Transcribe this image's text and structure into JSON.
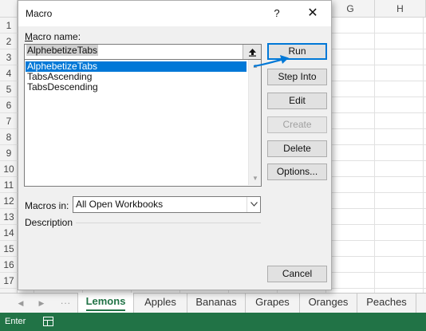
{
  "spreadsheet": {
    "columns": [
      "G",
      "H"
    ],
    "rows": [
      "1",
      "2",
      "3",
      "4",
      "5",
      "6",
      "7",
      "8",
      "9",
      "10",
      "11",
      "12",
      "13",
      "14",
      "15",
      "16",
      "17"
    ]
  },
  "sheet_tabs": [
    "Lemons",
    "Apples",
    "Bananas",
    "Grapes",
    "Oranges",
    "Peaches"
  ],
  "tab_nav": {
    "left_icon": "triangle-left-icon",
    "right_icon": "triangle-right-icon",
    "more": "..."
  },
  "status_bar": {
    "mode": "Enter",
    "icon": "sheet-view-icon",
    "color": "#217346"
  },
  "dialog": {
    "title": "Macro",
    "help_label": "?",
    "close_label": "✕",
    "macro_name_label": "Macro name:",
    "macro_name_value": "AlphebetizeTabs",
    "macro_list": [
      "AlphebetizeTabs",
      "TabsAscending",
      "TabsDescending"
    ],
    "selected_macro_index": 0,
    "buttons": {
      "run": "Run",
      "step_into": "Step Into",
      "edit": "Edit",
      "create": "Create",
      "delete": "Delete",
      "options": "Options...",
      "cancel": "Cancel"
    },
    "macros_in_label": "Macros in:",
    "macros_in_value": "All Open Workbooks",
    "description_label": "Description",
    "accent_color": "#0078d7"
  }
}
